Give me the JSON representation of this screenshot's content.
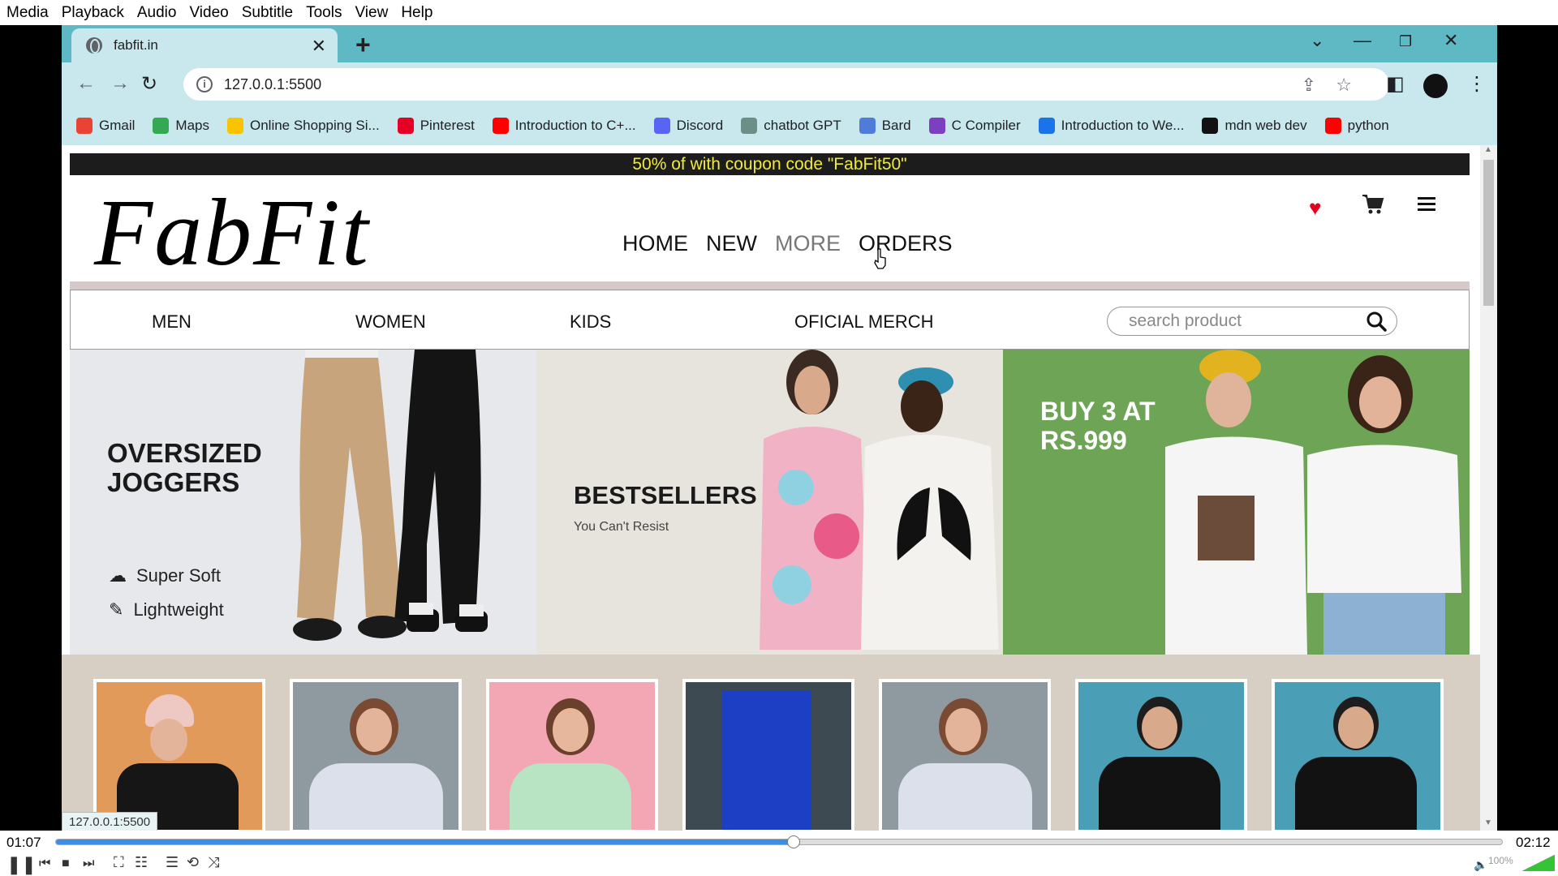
{
  "vlc": {
    "menu": [
      "Media",
      "Playback",
      "Audio",
      "Video",
      "Subtitle",
      "Tools",
      "View",
      "Help"
    ],
    "time_elapsed": "01:07",
    "time_total": "02:12",
    "progress": 0.51,
    "volume": "100%"
  },
  "browser": {
    "tab_title": "fabfit.in",
    "url": "127.0.0.1:5500",
    "status_url": "127.0.0.1:5500",
    "bookmarks": [
      {
        "label": "Gmail",
        "color": "#ea4335"
      },
      {
        "label": "Maps",
        "color": "#34a853"
      },
      {
        "label": "Online Shopping Si...",
        "color": "#f8c400"
      },
      {
        "label": "Pinterest",
        "color": "#e60023"
      },
      {
        "label": "Introduction to C+...",
        "color": "#ff0000"
      },
      {
        "label": "Discord",
        "color": "#5865f2"
      },
      {
        "label": "chatbot GPT",
        "color": "#6b8f84"
      },
      {
        "label": "Bard",
        "color": "#4f7bd9"
      },
      {
        "label": "C Compiler",
        "color": "#7b3fbf"
      },
      {
        "label": "Introduction to We...",
        "color": "#1a73e8"
      },
      {
        "label": "mdn web dev",
        "color": "#111111"
      },
      {
        "label": "python",
        "color": "#ff0000"
      }
    ]
  },
  "site": {
    "promo": "50% of with coupon code \"FabFit50\"",
    "logo": "FabFit",
    "nav": [
      "HOME",
      "NEW",
      "MORE",
      "ORDERS"
    ],
    "categories": [
      "MEN",
      "WOMEN",
      "KIDS",
      "OFICIAL MERCH"
    ],
    "search_placeholder": "search product",
    "banners": {
      "b1_title_line1": "OVERSIZED",
      "b1_title_line2": "JOGGERS",
      "b1_feature1": "Super Soft",
      "b1_feature2": "Lightweight",
      "b2_title": "BESTSELLERS",
      "b2_subtitle": "You Can't Resist",
      "b3_title_line1": "BUY 3 AT",
      "b3_title_line2": "RS.999"
    },
    "accent_heart": "#e8001c"
  }
}
